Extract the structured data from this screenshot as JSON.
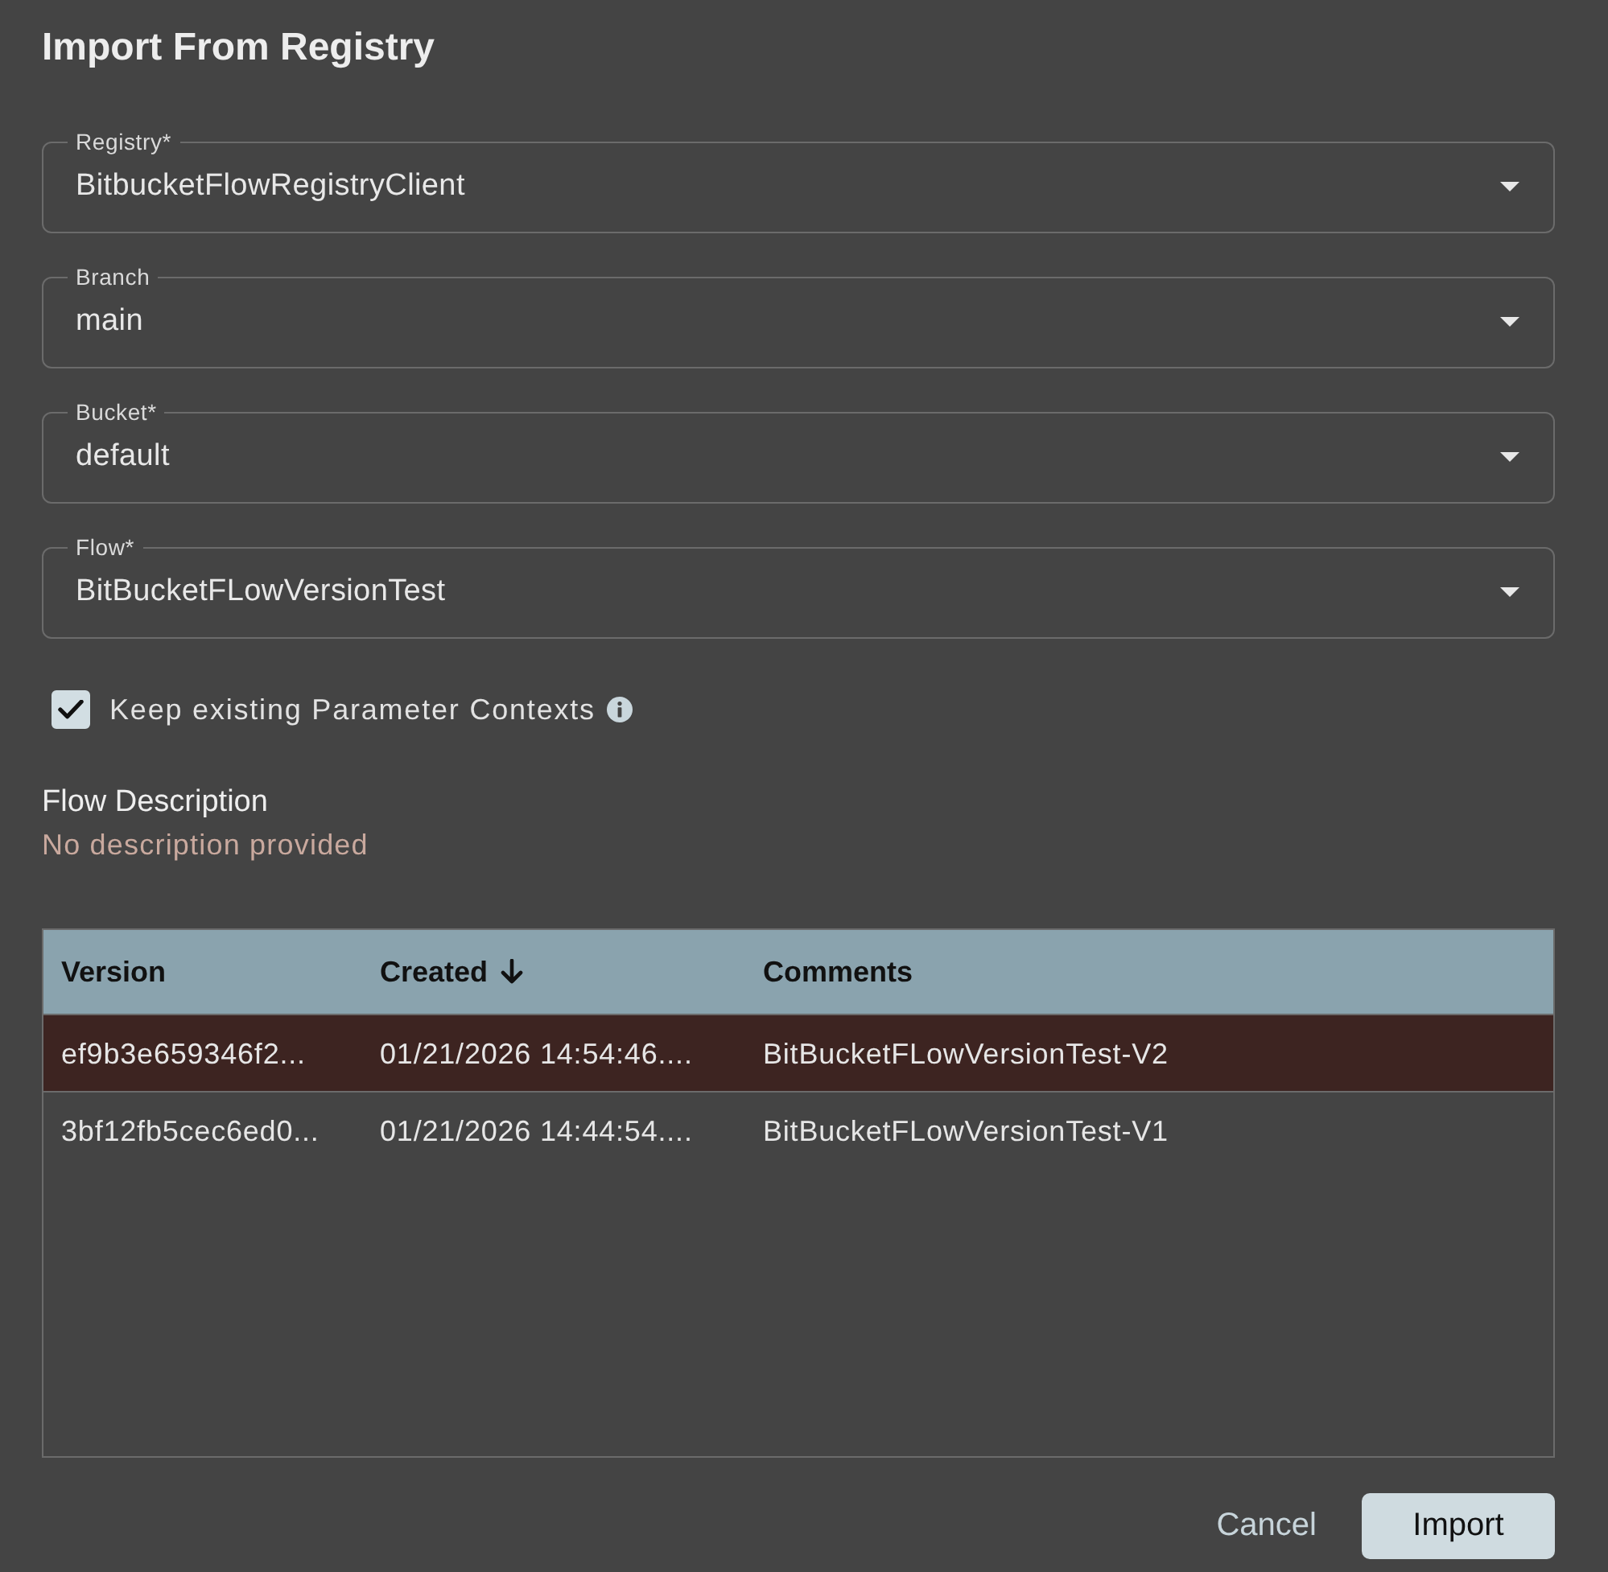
{
  "dialog": {
    "title": "Import From Registry"
  },
  "fields": [
    {
      "label": "Registry*",
      "value": "BitbucketFlowRegistryClient"
    },
    {
      "label": "Branch",
      "value": "main"
    },
    {
      "label": "Bucket*",
      "value": "default"
    },
    {
      "label": "Flow*",
      "value": "BitBucketFLowVersionTest"
    }
  ],
  "checkbox": {
    "label": "Keep existing Parameter Contexts",
    "checked": true
  },
  "description": {
    "heading": "Flow Description",
    "text": "No description provided"
  },
  "table": {
    "columns": [
      {
        "label": "Version",
        "sorted": false
      },
      {
        "label": "Created",
        "sorted": true
      },
      {
        "label": "Comments",
        "sorted": false
      }
    ],
    "rows": [
      {
        "cells": [
          "ef9b3e659346f2...",
          "01/21/2026 14:54:46....",
          "BitBucketFLowVersionTest-V2"
        ],
        "selected": true
      },
      {
        "cells": [
          "3bf12fb5cec6ed0...",
          "01/21/2026 14:44:54....",
          "BitBucketFLowVersionTest-V1"
        ],
        "selected": false
      }
    ]
  },
  "buttons": [
    {
      "label": "Cancel",
      "kind": "text"
    },
    {
      "label": "Import",
      "kind": "filled"
    }
  ]
}
